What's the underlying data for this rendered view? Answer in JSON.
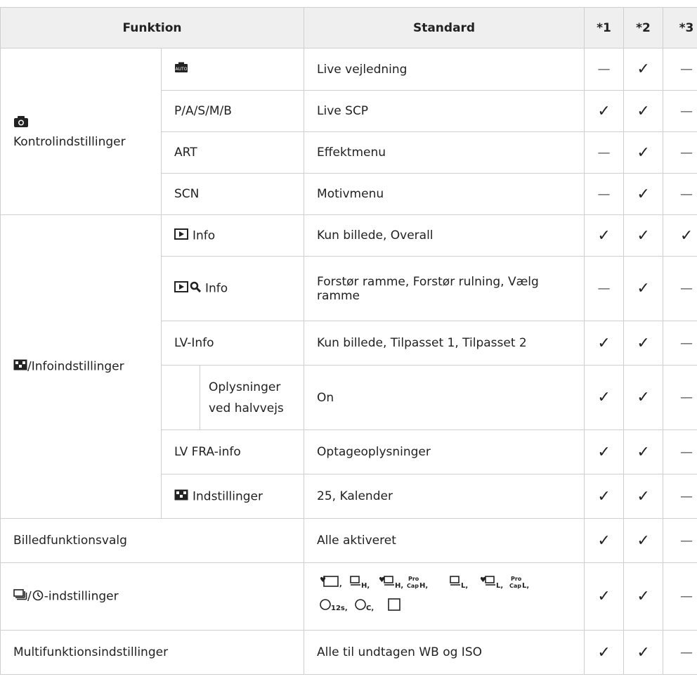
{
  "header": {
    "col_function": "Funktion",
    "col_standard": "Standard",
    "col_1": "*1",
    "col_2": "*2",
    "col_3": "*3"
  },
  "groups": {
    "kontrol": "Kontrolindstillinger",
    "info": "/Infoindstillinger",
    "billed": "Billedfunktionsvalg",
    "seq": "/",
    "seq_suffix": "-indstillinger",
    "multi": "Multifunktionsindstillinger"
  },
  "rows": [
    {
      "mode": "",
      "std": "Live vejledning",
      "c1": "—",
      "c2": "✓",
      "c3": "—"
    },
    {
      "mode": "P/A/S/M/B",
      "std": "Live SCP",
      "c1": "✓",
      "c2": "✓",
      "c3": "—"
    },
    {
      "mode": "ART",
      "std": "Effektmenu",
      "c1": "—",
      "c2": "✓",
      "c3": "—"
    },
    {
      "mode": "SCN",
      "std": "Motivmenu",
      "c1": "—",
      "c2": "✓",
      "c3": "—"
    },
    {
      "mode": "Info",
      "std": "Kun billede, Overall",
      "c1": "✓",
      "c2": "✓",
      "c3": "✓"
    },
    {
      "mode": "Info",
      "std": "Forstør ramme, Forstør rulning, Vælg ramme",
      "c1": "—",
      "c2": "✓",
      "c3": "—"
    },
    {
      "mode": "LV-Info",
      "std": "Kun billede, Tilpasset 1, Tilpasset 2",
      "c1": "✓",
      "c2": "✓",
      "c3": "—"
    },
    {
      "mode": "Oplysninger ved halvvejs",
      "std": "On",
      "c1": "✓",
      "c2": "✓",
      "c3": "—"
    },
    {
      "mode": "LV FRA-info",
      "std": "Optageoplysninger",
      "c1": "✓",
      "c2": "✓",
      "c3": "—"
    },
    {
      "mode": "Indstillinger",
      "std": "25, Kalender",
      "c1": "✓",
      "c2": "✓",
      "c3": "—"
    },
    {
      "std": "Alle aktiveret",
      "c1": "✓",
      "c2": "✓",
      "c3": "—"
    },
    {
      "std": "",
      "c1": "✓",
      "c2": "✓",
      "c3": "—"
    },
    {
      "std": "Alle til undtagen WB og ISO",
      "c1": "✓",
      "c2": "✓",
      "c3": "—"
    }
  ],
  "icons": {
    "camera": "camera-icon",
    "play": "play-icon",
    "magnifier": "magnifier-icon",
    "grid": "grid-icon",
    "auto": "auto-mode-icon",
    "sequential": "sequential-shooting-icon",
    "selftimer": "self-timer-icon"
  }
}
